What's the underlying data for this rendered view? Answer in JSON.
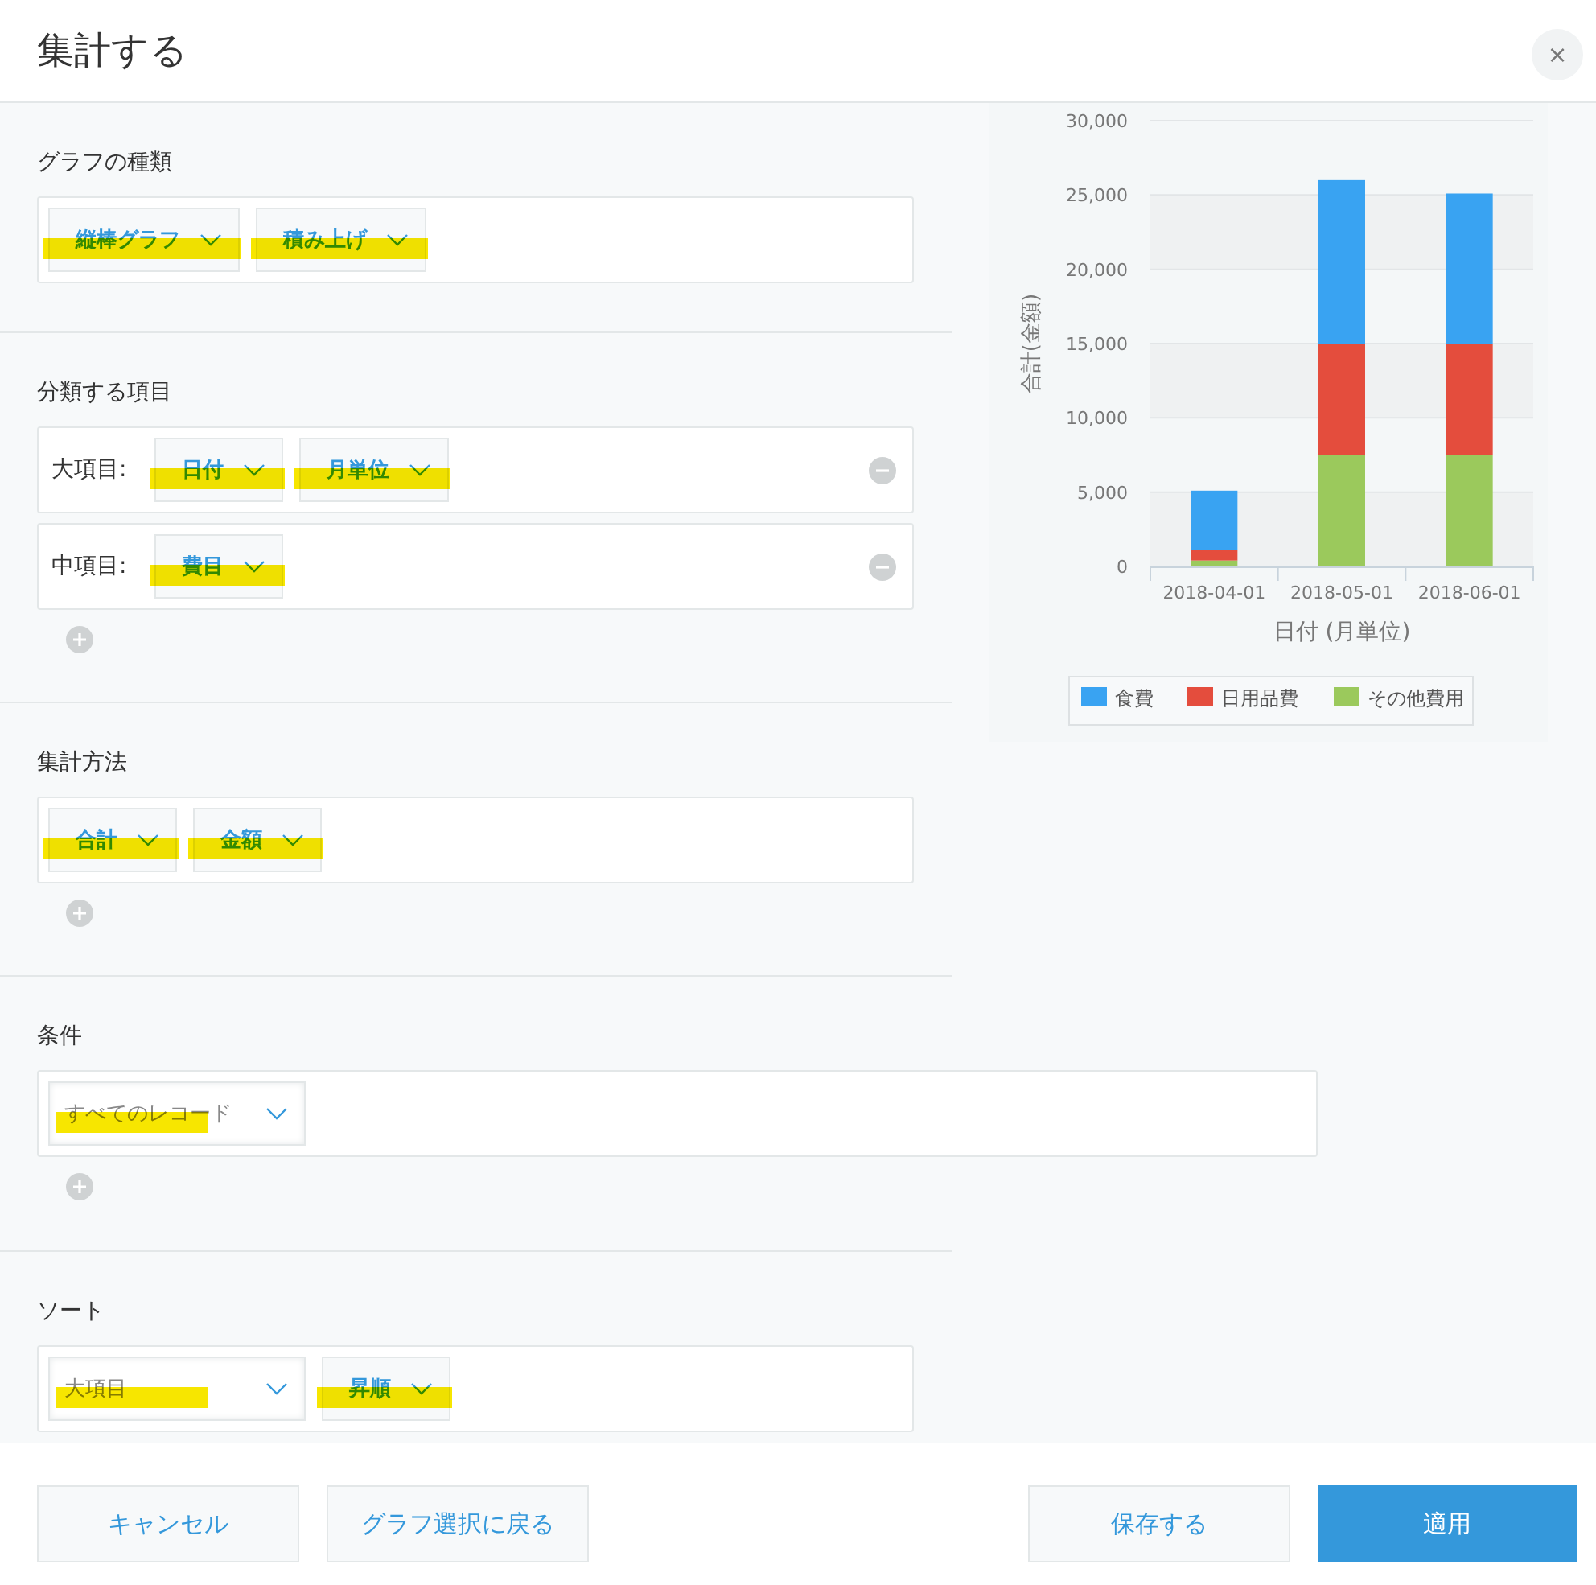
{
  "dialog": {
    "title": "集計する",
    "close_label": "×"
  },
  "sections": [
    {
      "title": "グラフの種類",
      "full_width": false,
      "can_add": false,
      "rows": [
        {
          "removable": false,
          "selects": [
            {
              "value": "縦棒グラフ",
              "kind": "compact",
              "highlighted": true
            },
            {
              "value": "積み上げ",
              "kind": "compact",
              "highlighted": true
            }
          ]
        }
      ]
    },
    {
      "title": "分類する項目",
      "full_width": false,
      "can_add": true,
      "rows": [
        {
          "label": "大項目:",
          "removable": true,
          "selects": [
            {
              "value": "日付",
              "kind": "compact",
              "highlighted": true
            },
            {
              "value": "月単位",
              "kind": "compact",
              "highlighted": true
            }
          ]
        },
        {
          "label": "中項目:",
          "removable": true,
          "selects": [
            {
              "value": "費目",
              "kind": "compact",
              "highlighted": true
            }
          ]
        }
      ]
    },
    {
      "title": "集計方法",
      "full_width": false,
      "can_add": true,
      "rows": [
        {
          "removable": false,
          "selects": [
            {
              "value": "合計",
              "kind": "compact",
              "highlighted": true
            },
            {
              "value": "金額",
              "kind": "compact",
              "highlighted": true
            }
          ]
        }
      ]
    },
    {
      "title": "条件",
      "full_width": true,
      "can_add": true,
      "rows": [
        {
          "removable": false,
          "selects": [
            {
              "value": "すべてのレコード",
              "kind": "wide",
              "highlighted": true
            }
          ]
        }
      ]
    },
    {
      "title": "ソート",
      "full_width": false,
      "can_add": false,
      "rows": [
        {
          "removable": false,
          "selects": [
            {
              "value": "大項目",
              "kind": "wide",
              "highlighted": true
            },
            {
              "value": "昇順",
              "kind": "compact",
              "highlighted": true
            }
          ]
        }
      ]
    }
  ],
  "chart": {
    "chart_data": {
      "type": "bar",
      "stacked": true,
      "orientation": "vertical",
      "xlabel": "日付 (月単位)",
      "ylabel": "合計(金額)",
      "categories": [
        "2018-04-01",
        "2018-05-01",
        "2018-06-01"
      ],
      "series": [
        {
          "name": "食費",
          "color": "#39a3f2",
          "values": [
            4000,
            11000,
            10100
          ]
        },
        {
          "name": "日用品費",
          "color": "#e44d3d",
          "values": [
            700,
            7500,
            7500
          ]
        },
        {
          "name": "その他費用",
          "color": "#9bc95c",
          "values": [
            400,
            7500,
            7500
          ]
        }
      ],
      "ylim": [
        0,
        30000
      ],
      "grid": true,
      "legend": true,
      "yticks": [
        {
          "value": 0,
          "label": "0"
        },
        {
          "value": 5000,
          "label": "5,000"
        },
        {
          "value": 10000,
          "label": "10,000"
        },
        {
          "value": 15000,
          "label": "15,000"
        },
        {
          "value": 20000,
          "label": "20,000"
        },
        {
          "value": 25000,
          "label": "25,000"
        },
        {
          "value": 30000,
          "label": "30,000"
        }
      ]
    }
  },
  "footer": {
    "buttons": [
      {
        "label": "キャンセル",
        "kind": "secondary"
      },
      {
        "label": "グラフ選択に戻る",
        "kind": "secondary"
      },
      {
        "label": "保存する",
        "kind": "secondary"
      },
      {
        "label": "適用",
        "kind": "primary"
      }
    ]
  }
}
